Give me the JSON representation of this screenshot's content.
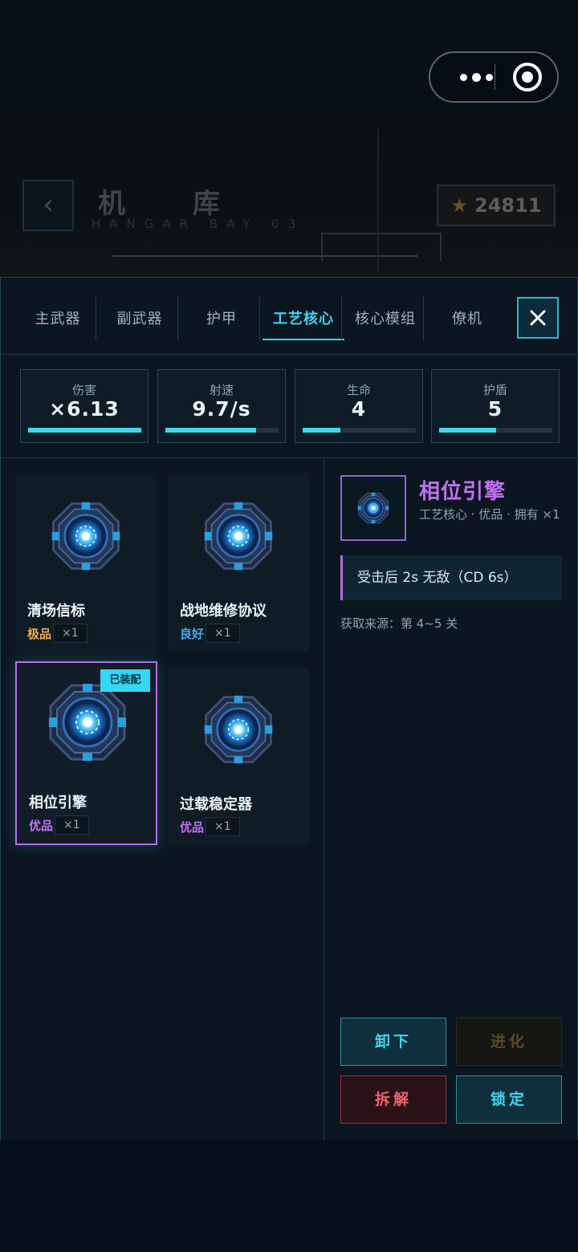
{
  "header": {
    "title": "机 库",
    "subtitle": "HANGAR BAY 03",
    "back_glyph": "‹",
    "currency": {
      "icon": "star-icon",
      "value": "24811"
    }
  },
  "tabs": [
    {
      "label": "主武器",
      "active": false
    },
    {
      "label": "副武器",
      "active": false
    },
    {
      "label": "护甲",
      "active": false
    },
    {
      "label": "工艺核心",
      "active": true
    },
    {
      "label": "核心模组",
      "active": false
    },
    {
      "label": "僚机",
      "active": false
    }
  ],
  "stats": [
    {
      "label": "伤害",
      "value": "×6.13",
      "bar_fraction": 1.0
    },
    {
      "label": "射速",
      "value": "9.7/s",
      "bar_fraction": 0.8
    },
    {
      "label": "生命",
      "value": "4",
      "bar_fraction": 0.33
    },
    {
      "label": "护盾",
      "value": "5",
      "bar_fraction": 0.5
    }
  ],
  "items": [
    {
      "name": "清场信标",
      "rarity": "极品",
      "rarity_color": "#f0a94a",
      "count": "×1",
      "equipped": false
    },
    {
      "name": "战地维修协议",
      "rarity": "良好",
      "rarity_color": "#45a8f0",
      "count": "×1",
      "equipped": false
    },
    {
      "name": "相位引擎",
      "rarity": "优品",
      "rarity_color": "#c071f2",
      "count": "×1",
      "equipped": true,
      "equipped_label": "已装配"
    },
    {
      "name": "过载稳定器",
      "rarity": "优品",
      "rarity_color": "#c071f2",
      "count": "×1",
      "equipped": false
    }
  ],
  "detail": {
    "name": "相位引擎",
    "meta": "工艺核心 · 优品 · 拥有 ×1",
    "effect": "受击后 2s 无敌（CD 6s）",
    "source": "获取来源：第 4~5 关"
  },
  "actions": {
    "unequip": "卸下",
    "evolve": "进化",
    "dismantle": "拆解",
    "lock": "锁定"
  }
}
